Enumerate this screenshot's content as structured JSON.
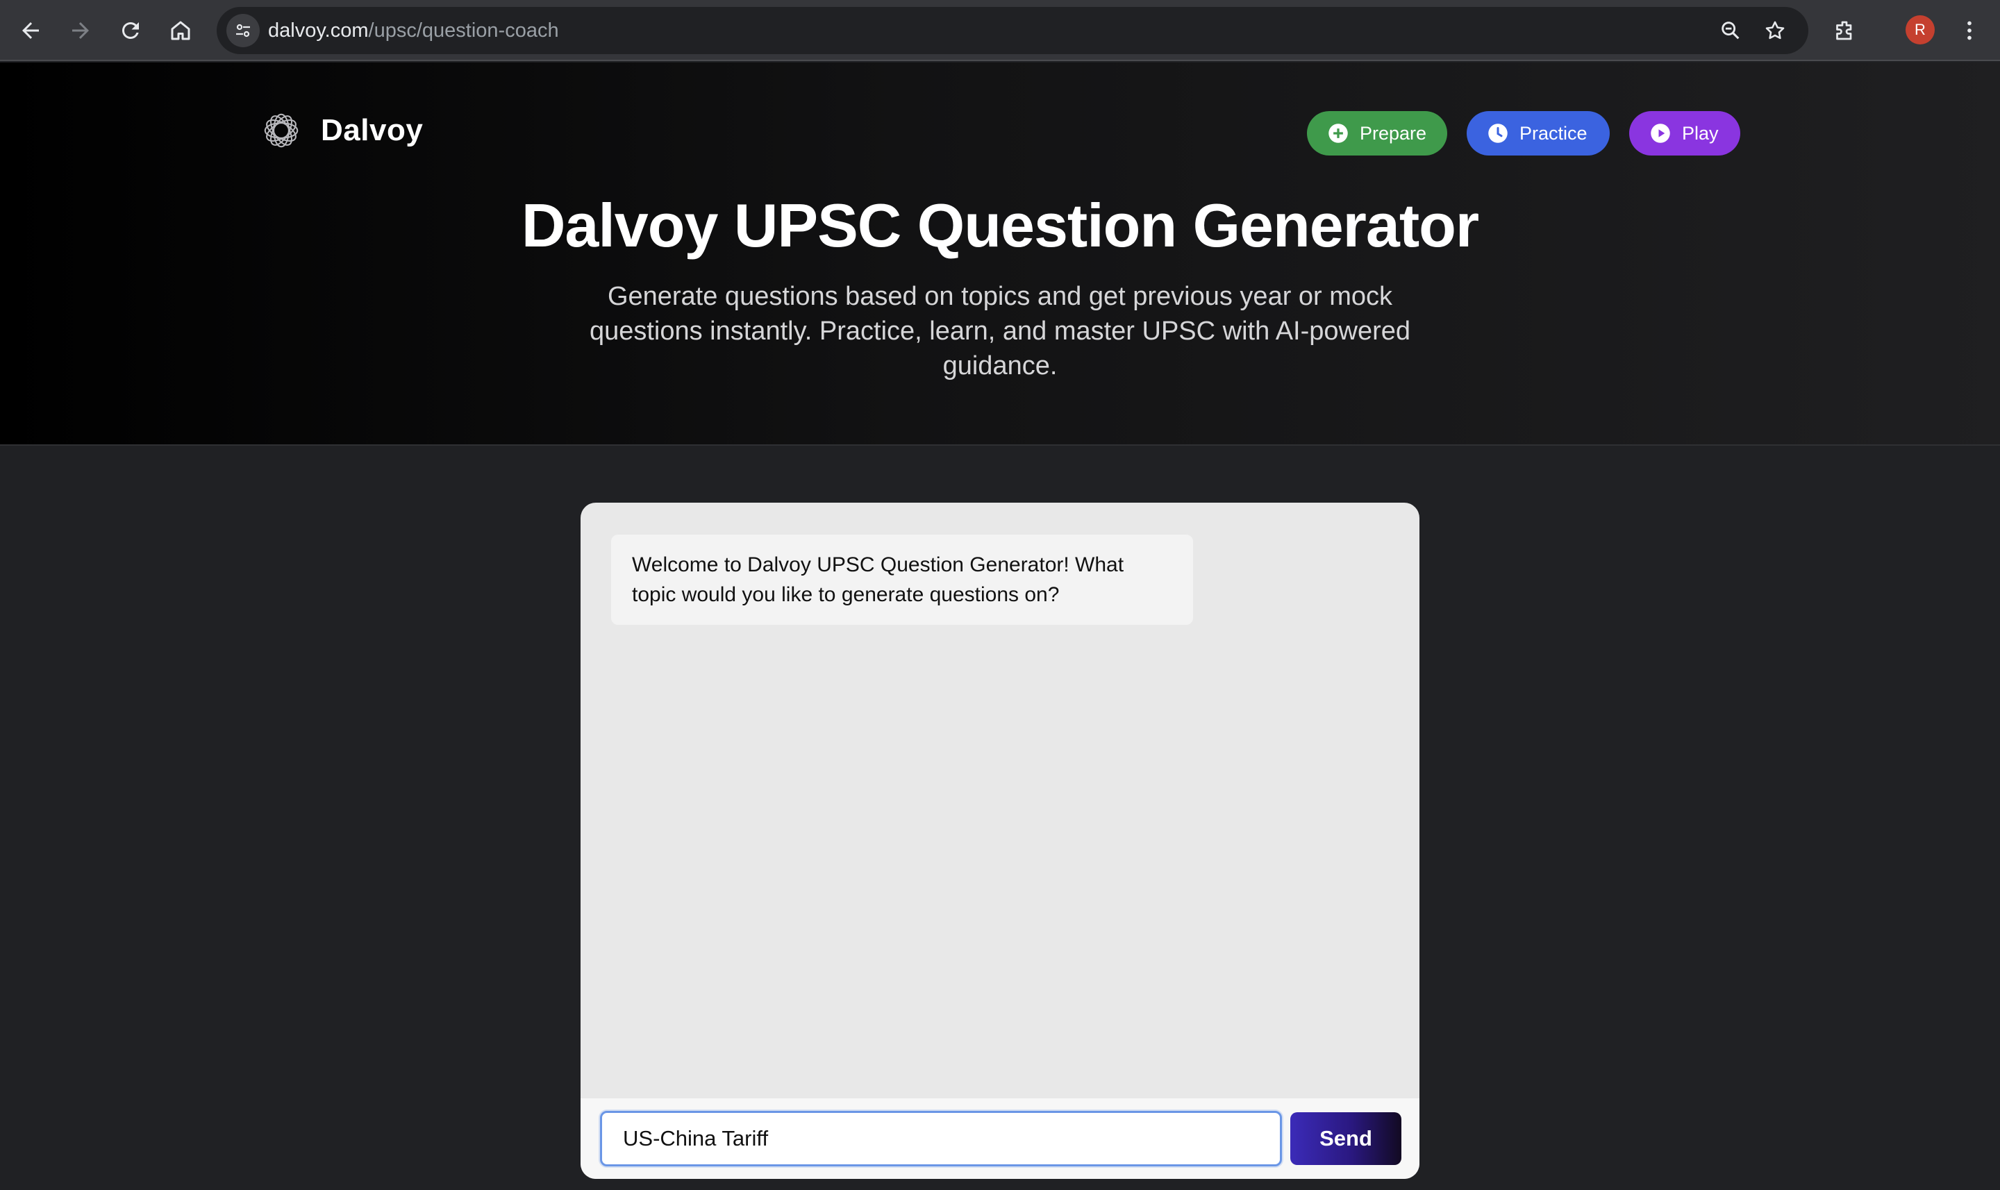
{
  "browser": {
    "url_host": "dalvoy.com",
    "url_path": "/upsc/question-coach",
    "profile_initial": "R"
  },
  "header": {
    "brand_name": "Dalvoy",
    "nav": [
      {
        "label": "Prepare",
        "icon": "plus-circle-icon",
        "color": "#3f9a4b"
      },
      {
        "label": "Practice",
        "icon": "clock-icon",
        "color": "#3b63e0"
      },
      {
        "label": "Play",
        "icon": "play-circle-icon",
        "color": "#8a35e0"
      }
    ]
  },
  "hero": {
    "title": "Dalvoy UPSC Question Generator",
    "subtitle": "Generate questions based on topics and get previous year or mock questions instantly. Practice, learn, and master UPSC with AI-powered guidance."
  },
  "chat": {
    "messages": [
      {
        "role": "bot",
        "text": "Welcome to Dalvoy UPSC Question Generator! What topic would you like to generate questions on?"
      }
    ],
    "input_value": "US-China Tariff ",
    "send_label": "Send"
  }
}
